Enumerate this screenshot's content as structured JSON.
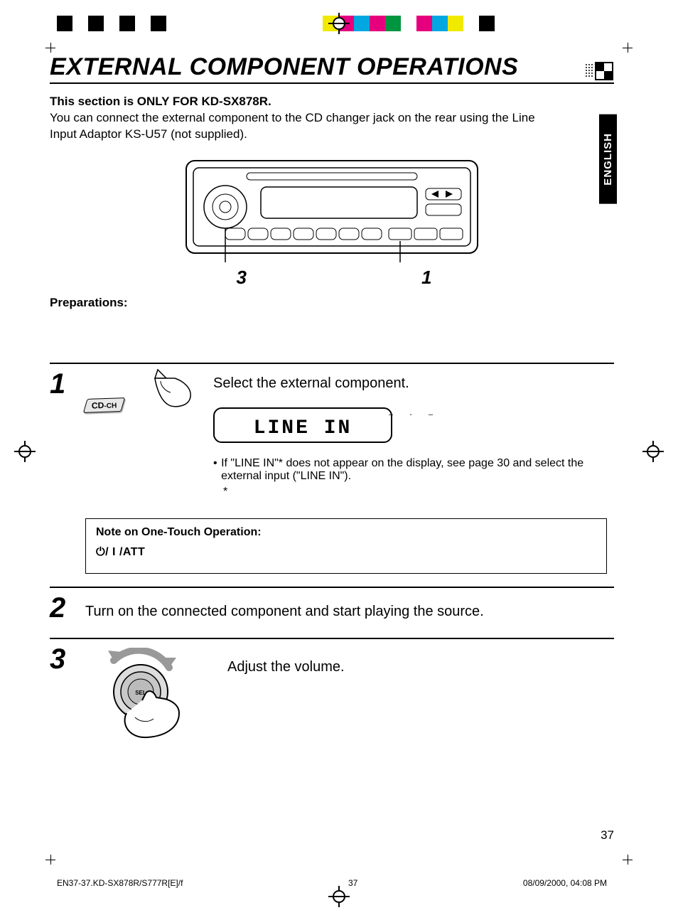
{
  "color_bar": [
    "#000000",
    "#ffffff",
    "#000000",
    "#ffffff",
    "#000000",
    "#ffffff",
    "#000000",
    "#ffffff",
    "#000000",
    "#ffffff",
    "#ffffff",
    "#f2e900",
    "#e6007e",
    "#00a7e1",
    "#e6007e",
    "#009640",
    "#ffffff",
    "#e6007e",
    "#00a7e1",
    "#f2e900",
    "#ffffff",
    "#000000"
  ],
  "title": "EXTERNAL COMPONENT OPERATIONS",
  "language_tab": "ENGLISH",
  "intro_bold": "This section is ONLY FOR KD-SX878R.",
  "intro_body": "You can connect the external component to the CD changer jack on the rear using the Line Input Adaptor KS-U57 (not supplied).",
  "callout_left": "3",
  "callout_right": "1",
  "preparations_heading": "Preparations:",
  "steps": {
    "s1": {
      "num": "1",
      "button_label_main": "CD",
      "button_label_sub": "-CH",
      "heading": "Select the external component.",
      "lcd": "LINE IN",
      "bullet": "If \"LINE IN\"* does not appear on the display, see page 30 and select the external input (\"LINE IN\").",
      "asterisk": "*"
    },
    "note_box": {
      "title": "Note on One-Touch Operation:",
      "icon_label": "/ I /ATT"
    },
    "s2": {
      "num": "2",
      "text": "Turn on the connected component and start playing the source."
    },
    "s3": {
      "num": "3",
      "text": "Adjust the volume.",
      "knob_label": "SEL"
    }
  },
  "page_number": "37",
  "footer": {
    "left": "EN37-37.KD-SX878R/S777R[E]/f",
    "center": "37",
    "right": "08/09/2000, 04:08 PM"
  }
}
